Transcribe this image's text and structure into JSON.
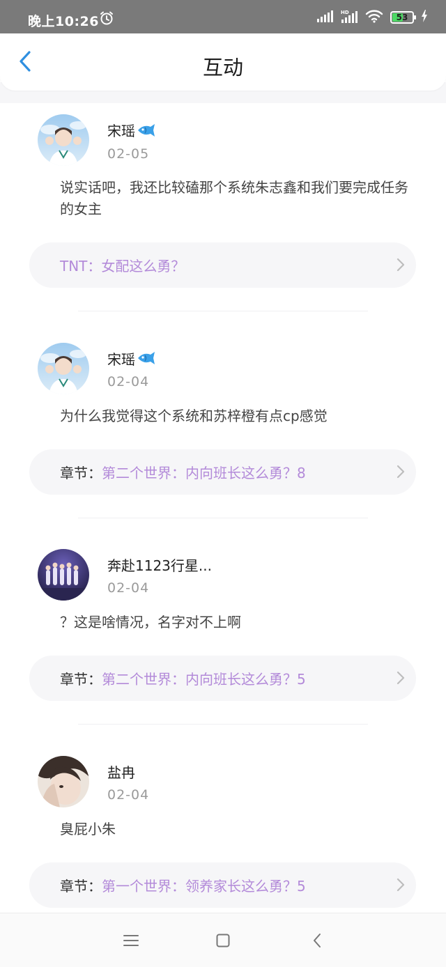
{
  "status_bar": {
    "time": "晚上10:26",
    "battery": "53",
    "battery_level": 0.53,
    "icons": [
      "alarm-icon",
      "signal-icon",
      "hd-signal-icon",
      "wifi-icon",
      "battery-icon",
      "charging-icon"
    ]
  },
  "header": {
    "title": "互动",
    "back_icon": "chevron-left-icon"
  },
  "colors": {
    "accent": "#2f8fe0",
    "link": "#b38ad9",
    "status_bar": "#7a7a7a",
    "card_bg": "#f6f6f8"
  },
  "feed": [
    {
      "user": "宋瑶",
      "badge_icon": "fish-icon",
      "date": "02-05",
      "content": "说实话吧，我还比较磕那个系统朱志鑫和我们要完成任务的女主",
      "link_label": "",
      "link_text": "TNT：女配这么勇？"
    },
    {
      "user": "宋瑶",
      "badge_icon": "fish-icon",
      "date": "02-04",
      "content": "为什么我觉得这个系统和苏梓橙有点cp感觉",
      "link_label": "章节：",
      "link_text": "第二个世界：内向班长这么勇？8"
    },
    {
      "user": "奔赴1123行星...",
      "badge_icon": "",
      "date": "02-04",
      "content": "？这是啥情况，名字对不上啊",
      "link_label": "章节：",
      "link_text": "第二个世界：内向班长这么勇？5"
    },
    {
      "user": "盐冉",
      "badge_icon": "",
      "date": "02-04",
      "content": "臭屁小朱",
      "link_label": "章节：",
      "link_text": "第一个世界：领养家长这么勇？5"
    }
  ],
  "nav_bar": {
    "icons": [
      "menu-icon",
      "home-square-icon",
      "back-triangle-icon"
    ]
  }
}
